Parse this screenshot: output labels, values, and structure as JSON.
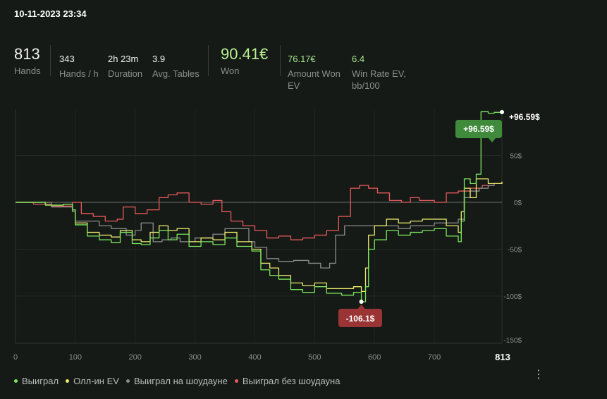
{
  "header": {
    "datetime": "10-11-2023 23:34"
  },
  "stats": {
    "hands": {
      "value": "813",
      "label": "Hands"
    },
    "hands_per_hour": {
      "value": "343",
      "label": "Hands / h"
    },
    "duration": {
      "value": "2h 23m",
      "label": "Duration"
    },
    "avg_tables": {
      "value": "3.9",
      "label": "Avg. Tables"
    },
    "won": {
      "value": "90.41€",
      "label": "Won"
    },
    "amount_won_ev": {
      "value": "76.17€",
      "label_line1": "Amount Won",
      "label_line2": "EV"
    },
    "win_rate_ev": {
      "value": "6.4",
      "label_line1": "Win Rate EV,",
      "label_line2": "bb/100"
    }
  },
  "colors": {
    "won": "#7ae85c",
    "allin_ev": "#ecec6a",
    "showdown": "#8c8c8c",
    "non_showdown": "#e85a5a",
    "max_badge": "#3f8a3b",
    "min_badge": "#9b3535"
  },
  "chart_data": {
    "type": "line",
    "xlim": [
      0,
      813
    ],
    "ylim": [
      -150,
      100
    ],
    "x_ticks": [
      "0",
      "100",
      "200",
      "300",
      "400",
      "500",
      "600",
      "700"
    ],
    "x_end_label": "813",
    "y_ticks": [
      "50$",
      "0$",
      "-50$",
      "-100$",
      "-150$"
    ],
    "y_tick_values": [
      50,
      0,
      -50,
      -100,
      -150
    ],
    "x_tick_values": [
      0,
      100,
      200,
      300,
      400,
      500,
      600,
      700
    ],
    "max_label": "+96.59$",
    "max_point": [
      778,
      96.59
    ],
    "end_label": "+96.59$",
    "end_point": [
      813,
      96.59
    ],
    "min_label": "-106.1$",
    "min_point": [
      578,
      -106.1
    ],
    "legend_position": "bottom-left",
    "series": [
      {
        "name": "Выиграл",
        "color": "#7ae85c",
        "x": [
          0,
          50,
          80,
          95,
          100,
          120,
          140,
          160,
          175,
          195,
          210,
          225,
          240,
          255,
          270,
          290,
          310,
          330,
          350,
          370,
          395,
          410,
          425,
          440,
          460,
          480,
          500,
          520,
          545,
          565,
          578,
          585,
          590,
          600,
          620,
          640,
          660,
          680,
          700,
          720,
          740,
          745,
          750,
          760,
          770,
          778,
          790,
          800,
          813
        ],
        "y": [
          0,
          -3,
          -2,
          -8,
          -24,
          -36,
          -40,
          -43,
          -32,
          -44,
          -45,
          -38,
          -30,
          -40,
          -34,
          -47,
          -42,
          -45,
          -38,
          -47,
          -52,
          -72,
          -78,
          -82,
          -93,
          -96,
          -90,
          -97,
          -99,
          -96,
          -106.1,
          -90,
          -50,
          -40,
          -30,
          -35,
          -32,
          -30,
          -28,
          -36,
          -42,
          -20,
          25,
          20,
          30,
          96.59,
          95,
          96,
          96.59
        ]
      },
      {
        "name": "Олл-ин EV",
        "color": "#ecec6a",
        "x": [
          0,
          50,
          80,
          95,
          100,
          120,
          140,
          160,
          175,
          195,
          210,
          225,
          240,
          255,
          270,
          290,
          310,
          330,
          350,
          370,
          395,
          410,
          425,
          440,
          460,
          480,
          500,
          520,
          545,
          565,
          578,
          585,
          590,
          600,
          620,
          640,
          660,
          680,
          700,
          720,
          740,
          745,
          750,
          760,
          770,
          790,
          813
        ],
        "y": [
          0,
          -3,
          -2,
          -8,
          -22,
          -32,
          -35,
          -37,
          -30,
          -40,
          -42,
          -32,
          -25,
          -30,
          -28,
          -42,
          -38,
          -40,
          -32,
          -42,
          -50,
          -65,
          -70,
          -78,
          -86,
          -89,
          -86,
          -92,
          -92,
          -90,
          -95,
          -70,
          -35,
          -25,
          -18,
          -22,
          -20,
          -18,
          -18,
          -25,
          -32,
          -10,
          15,
          5,
          25,
          20,
          22
        ]
      },
      {
        "name": "Выиграл на шоудауне",
        "color": "#8c8c8c",
        "x": [
          0,
          60,
          95,
          100,
          140,
          160,
          185,
          200,
          210,
          230,
          245,
          260,
          275,
          300,
          330,
          350,
          375,
          390,
          400,
          420,
          440,
          465,
          490,
          510,
          525,
          535,
          550,
          600,
          640,
          660,
          700,
          740,
          750,
          760,
          775,
          790,
          800,
          813
        ],
        "y": [
          0,
          -5,
          -10,
          -20,
          -25,
          -28,
          -35,
          -30,
          -22,
          -42,
          -40,
          -38,
          -42,
          -38,
          -34,
          -28,
          -28,
          -42,
          -48,
          -60,
          -63,
          -62,
          -65,
          -70,
          -65,
          -35,
          -25,
          -25,
          -28,
          -25,
          -22,
          -18,
          5,
          12,
          15,
          18,
          20,
          22
        ]
      },
      {
        "name": "Выиграл без шоудауна",
        "color": "#e85a5a",
        "x": [
          0,
          30,
          60,
          95,
          110,
          130,
          150,
          170,
          180,
          200,
          220,
          240,
          255,
          270,
          290,
          310,
          330,
          345,
          360,
          380,
          400,
          420,
          440,
          460,
          480,
          500,
          520,
          540,
          560,
          575,
          590,
          605,
          625,
          645,
          660,
          675,
          700,
          720,
          740,
          760,
          780,
          800,
          813
        ],
        "y": [
          0,
          -2,
          -4,
          0,
          -12,
          -15,
          -20,
          -18,
          -5,
          -12,
          -8,
          5,
          8,
          10,
          0,
          -2,
          2,
          -10,
          -20,
          -25,
          -30,
          -38,
          -36,
          -40,
          -38,
          -35,
          -30,
          -15,
          15,
          18,
          15,
          10,
          2,
          0,
          5,
          2,
          0,
          10,
          12,
          15,
          18,
          20,
          22
        ]
      }
    ]
  },
  "legend": [
    {
      "label": "Выиграл",
      "color": "#7ae85c"
    },
    {
      "label": "Олл-ин EV",
      "color": "#ecec6a"
    },
    {
      "label": "Выиграл на шоудауне",
      "color": "#8c8c8c"
    },
    {
      "label": "Выиграл без шоудауна",
      "color": "#e85a5a"
    }
  ],
  "menu": {
    "more_glyph": "⋮"
  }
}
